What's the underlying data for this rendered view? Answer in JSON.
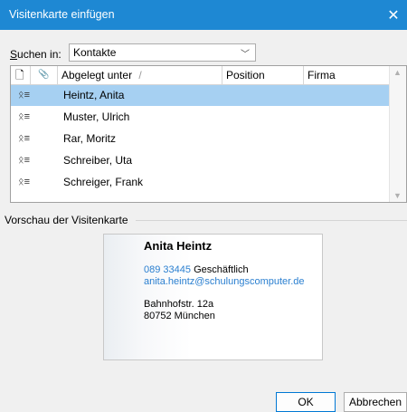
{
  "window": {
    "title": "Visitenkarte einfügen",
    "close_glyph": "✕"
  },
  "search": {
    "label_underlined": "S",
    "label_rest": "uchen in:",
    "value": "Kontakte"
  },
  "columns": {
    "icon1": "🗋",
    "icon2": "📎",
    "filed_as": "Abgelegt unter",
    "sort_glyph": "/",
    "position": "Position",
    "company": "Firma"
  },
  "contacts": [
    {
      "name": "Heintz, Anita",
      "selected": true
    },
    {
      "name": "Muster, Ulrich",
      "selected": false
    },
    {
      "name": "Rar, Moritz",
      "selected": false
    },
    {
      "name": "Schreiber, Uta",
      "selected": false
    },
    {
      "name": "Schreiger, Frank",
      "selected": false
    }
  ],
  "contact_icon_glyph": "ᛟ≡",
  "preview": {
    "group_label": "Vorschau der Visitenkarte",
    "name": "Anita Heintz",
    "phone": "089 33445",
    "phone_type": "Geschäftlich",
    "email": "anita.heintz@schulungscomputer.de",
    "street": "Bahnhofstr. 12a",
    "city": "80752 München"
  },
  "buttons": {
    "ok": "OK",
    "cancel": "Abbrechen"
  }
}
